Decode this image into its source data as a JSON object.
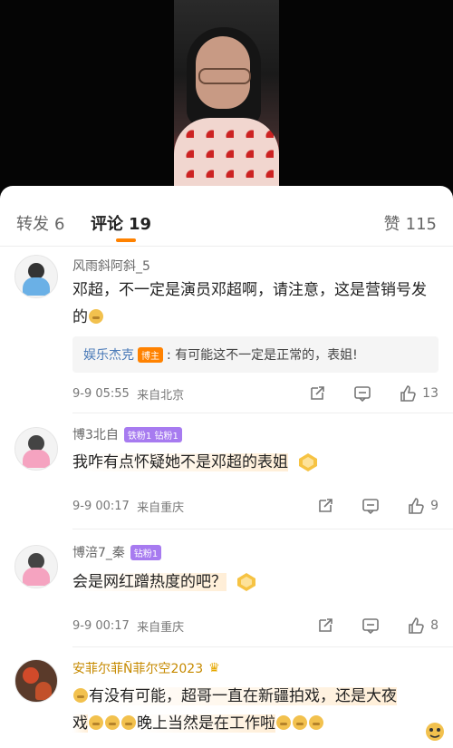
{
  "tabs": {
    "forward": {
      "label": "转发",
      "count": "6"
    },
    "comments": {
      "label": "评论",
      "count": "19"
    },
    "likes": {
      "label": "赞",
      "count": "115"
    }
  },
  "colors": {
    "accent": "#ff8200",
    "link": "#4a7ab8",
    "fan_badge": "#a77bf0"
  },
  "comments": [
    {
      "username": "风雨斜阿斜_5",
      "text": "邓超，不一定是演员邓超啊，请注意，这是营销号发的",
      "reply": {
        "name": "娱乐杰克",
        "badge": "博主",
        "text": ": 有可能这不一定是正常的，表姐!"
      },
      "time": "9-9 05:55",
      "location": "来自北京",
      "likes": "13"
    },
    {
      "username": "博3北自",
      "badge": "铁粉1 钻粉1",
      "text": "我咋有点怀疑她不是邓超的表姐",
      "time": "9-9 00:17",
      "location": "来自重庆",
      "likes": "9"
    },
    {
      "username": "博涪7_秦",
      "badge": "钻粉1",
      "text": "会是网红蹭热度的吧？",
      "time": "9-9 00:17",
      "location": "来自重庆",
      "likes": "8"
    },
    {
      "username": "安菲尔菲Ñ菲尔空2023",
      "text_line1": "有没有可能，超哥一直在新疆拍戏，还是大夜",
      "text_line2a": "戏",
      "text_line2b": "晚上当然是在工作啦"
    }
  ],
  "icons": [
    "share-icon",
    "comment-icon",
    "like-icon",
    "medal-icon",
    "crown-icon"
  ]
}
